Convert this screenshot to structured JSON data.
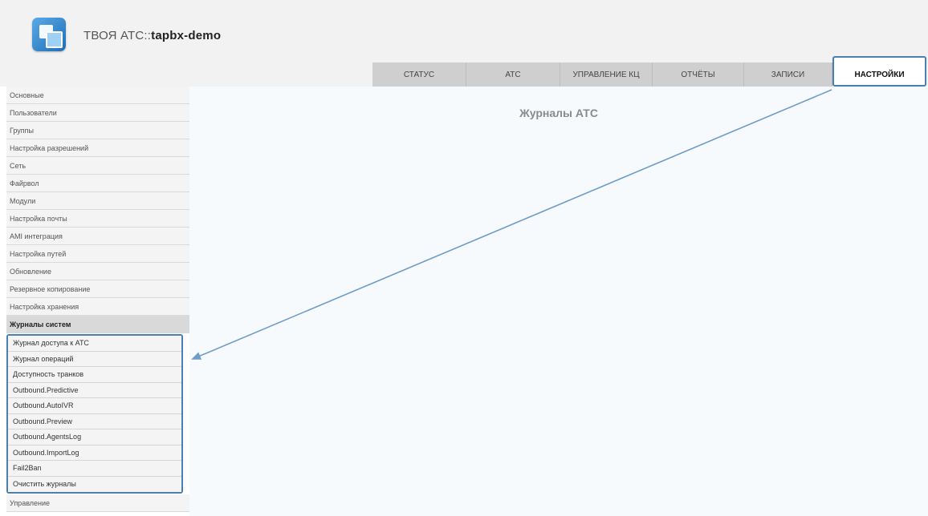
{
  "app": {
    "title_prefix": "ТВОЯ АТС::",
    "title_name": "tapbx-demo"
  },
  "nav": {
    "tabs": [
      {
        "label": "СТАТУС"
      },
      {
        "label": "АТС"
      },
      {
        "label": "УПРАВЛЕНИЕ КЦ"
      },
      {
        "label": "ОТЧЁТЫ"
      },
      {
        "label": "ЗАПИСИ"
      },
      {
        "label": "НАСТРОЙКИ",
        "active": true
      }
    ]
  },
  "sidebar": {
    "items": [
      {
        "label": "Основные"
      },
      {
        "label": "Пользователи"
      },
      {
        "label": "Группы"
      },
      {
        "label": "Настройка разрешений"
      },
      {
        "label": "Сеть"
      },
      {
        "label": "Файрвол"
      },
      {
        "label": "Модули"
      },
      {
        "label": "Настройка почты"
      },
      {
        "label": "AMI интеграция"
      },
      {
        "label": "Настройка путей"
      },
      {
        "label": "Обновление"
      },
      {
        "label": "Резервное копирование"
      },
      {
        "label": "Настройка хранения"
      }
    ],
    "section_header": "Журналы систем",
    "sub_items": [
      {
        "label": "Журнал доступа к АТС"
      },
      {
        "label": "Журнал операций"
      },
      {
        "label": "Доступность транков"
      },
      {
        "label": "Outbound.Predictive"
      },
      {
        "label": "Outbound.AutoIVR"
      },
      {
        "label": "Outbound.Preview"
      },
      {
        "label": "Outbound.AgentsLog"
      },
      {
        "label": "Outbound.ImportLog"
      },
      {
        "label": "Fail2Ban"
      },
      {
        "label": "Очистить журналы"
      }
    ],
    "last_item": "Управление"
  },
  "main": {
    "title": "Журналы АТС"
  },
  "colors": {
    "highlight": "#4a7fb6",
    "arrow": "#6f9cc9"
  }
}
